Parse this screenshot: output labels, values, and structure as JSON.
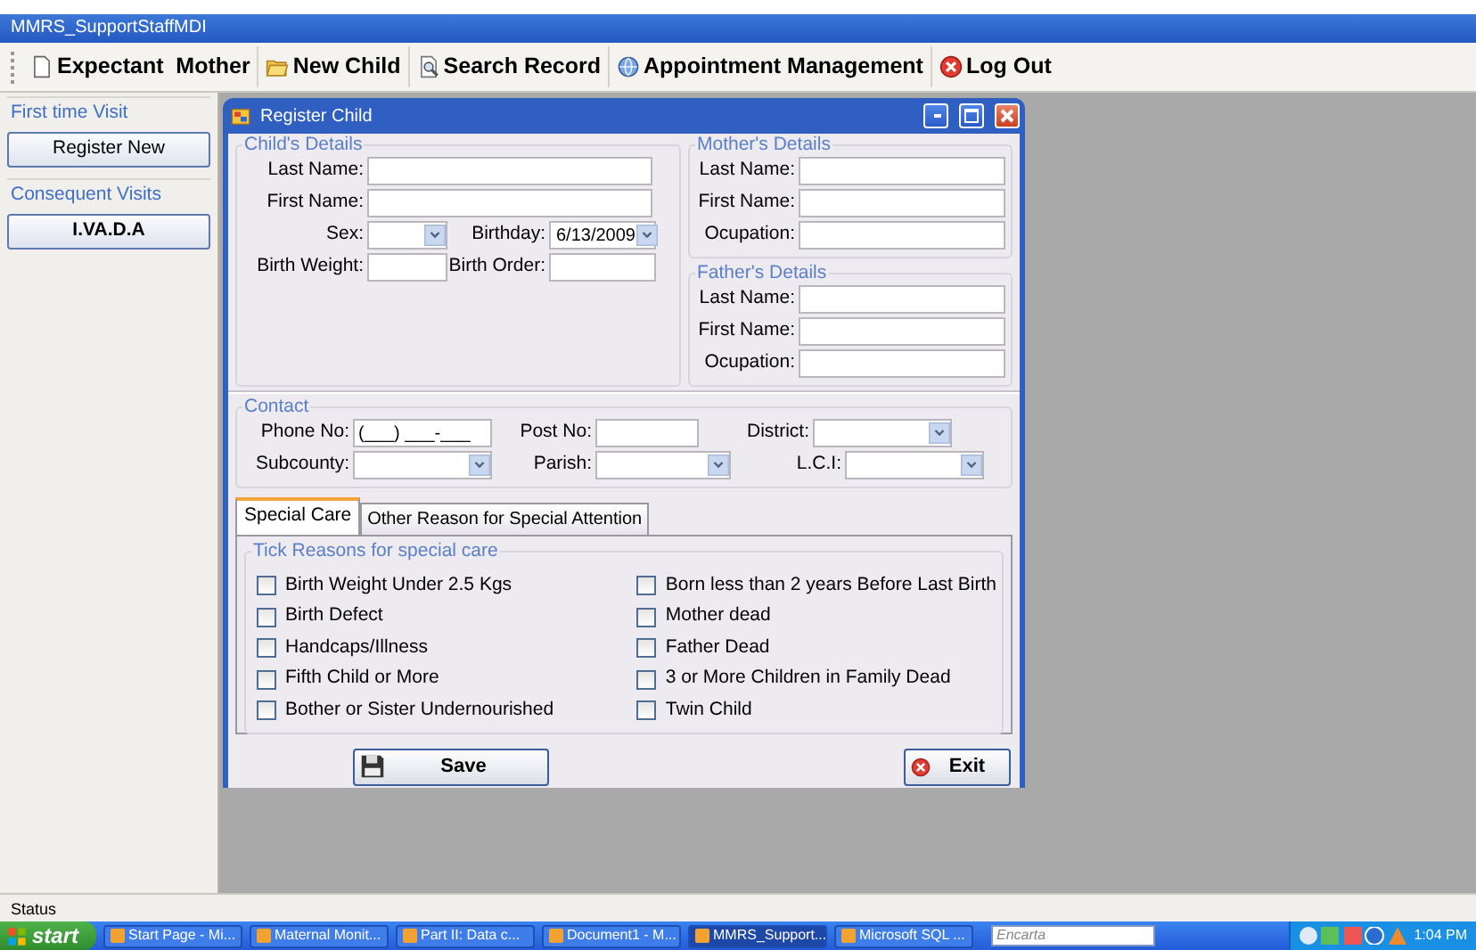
{
  "app_title": "MMRS_SupportStaffMDI",
  "toolbar": [
    {
      "label": "Expectant  Mother"
    },
    {
      "label": "New Child"
    },
    {
      "label": "Search Record"
    },
    {
      "label": "Appointment Management"
    },
    {
      "label": "Log Out"
    }
  ],
  "sidebar": [
    {
      "title": "First time Visit",
      "button": "Register New",
      "bold": false
    },
    {
      "title": "Consequent Visits",
      "button": "I.VA.D.A",
      "bold": true
    }
  ],
  "window": {
    "title": "Register Child",
    "childs_details": {
      "title": "Child's Details",
      "rows": [
        [
          {
            "label": "Last Name:",
            "kind": "text"
          }
        ],
        [
          {
            "label": "First Name:",
            "kind": "text"
          }
        ],
        [
          {
            "label": "Sex:",
            "kind": "combo"
          },
          {
            "label": "Birthday:",
            "kind": "date",
            "value": "6/13/2009"
          }
        ],
        [
          {
            "label": "Birth Weight:",
            "kind": "text"
          },
          {
            "label": "Birth Order:",
            "kind": "text"
          }
        ]
      ]
    },
    "mothers_details": {
      "title": "Mother's Details",
      "rows": [
        [
          {
            "label": "Last Name:",
            "kind": "text"
          }
        ],
        [
          {
            "label": "First Name:",
            "kind": "text"
          }
        ],
        [
          {
            "label": "Ocupation:",
            "kind": "text"
          }
        ]
      ]
    },
    "fathers_details": {
      "title": "Father's Details",
      "rows": [
        [
          {
            "label": "Last Name:",
            "kind": "text"
          }
        ],
        [
          {
            "label": "First Name:",
            "kind": "text"
          }
        ],
        [
          {
            "label": "Ocupation:",
            "kind": "text"
          }
        ]
      ]
    },
    "contact": {
      "title": "Contact",
      "rows": [
        [
          {
            "label": "Phone No:",
            "kind": "text",
            "value": "(___) ___-___"
          },
          {
            "label": "Post No:",
            "kind": "text"
          },
          {
            "label": "District:",
            "kind": "combo"
          }
        ],
        [
          {
            "label": "Subcounty:",
            "kind": "combo"
          },
          {
            "label": "Parish:",
            "kind": "combo"
          },
          {
            "label": "L.C.I:",
            "kind": "combo"
          }
        ]
      ]
    },
    "tabs": [
      {
        "label": "Special Care",
        "selected": true
      },
      {
        "label": "Other Reason for Special Attention",
        "selected": false
      }
    ],
    "reasons": {
      "title": "Tick Reasons for special care",
      "columns": [
        [
          {
            "label": "Birth Weight Under 2.5 Kgs",
            "checked": false
          },
          {
            "label": "Birth Defect",
            "checked": false
          },
          {
            "label": "Handcaps/Illness",
            "checked": false
          },
          {
            "label": "Fifth Child or More",
            "checked": false
          },
          {
            "label": "Bother or Sister Undernourished",
            "checked": false
          }
        ],
        [
          {
            "label": "Born less than 2 years Before Last Birth",
            "checked": false
          },
          {
            "label": "Mother dead",
            "checked": false
          },
          {
            "label": "Father Dead",
            "checked": false
          },
          {
            "label": "3 or More Children in Family Dead",
            "checked": false
          },
          {
            "label": "Twin Child",
            "checked": false
          }
        ]
      ]
    },
    "buttons": [
      {
        "label": "Save"
      },
      {
        "label": "Exit"
      }
    ]
  },
  "status_bar": "Status",
  "taskbar": {
    "start": "start",
    "tasks": [
      {
        "label": "Start Page - Mi...",
        "selected": false
      },
      {
        "label": "Maternal Monit...",
        "selected": false
      },
      {
        "label": "Part II: Data c...",
        "selected": false
      },
      {
        "label": "Document1 - M...",
        "selected": false
      },
      {
        "label": "MMRS_Support...",
        "selected": true
      },
      {
        "label": "Microsoft SQL ...",
        "selected": false
      }
    ],
    "search_placeholder": "Encarta",
    "clock": "1:04 PM"
  }
}
